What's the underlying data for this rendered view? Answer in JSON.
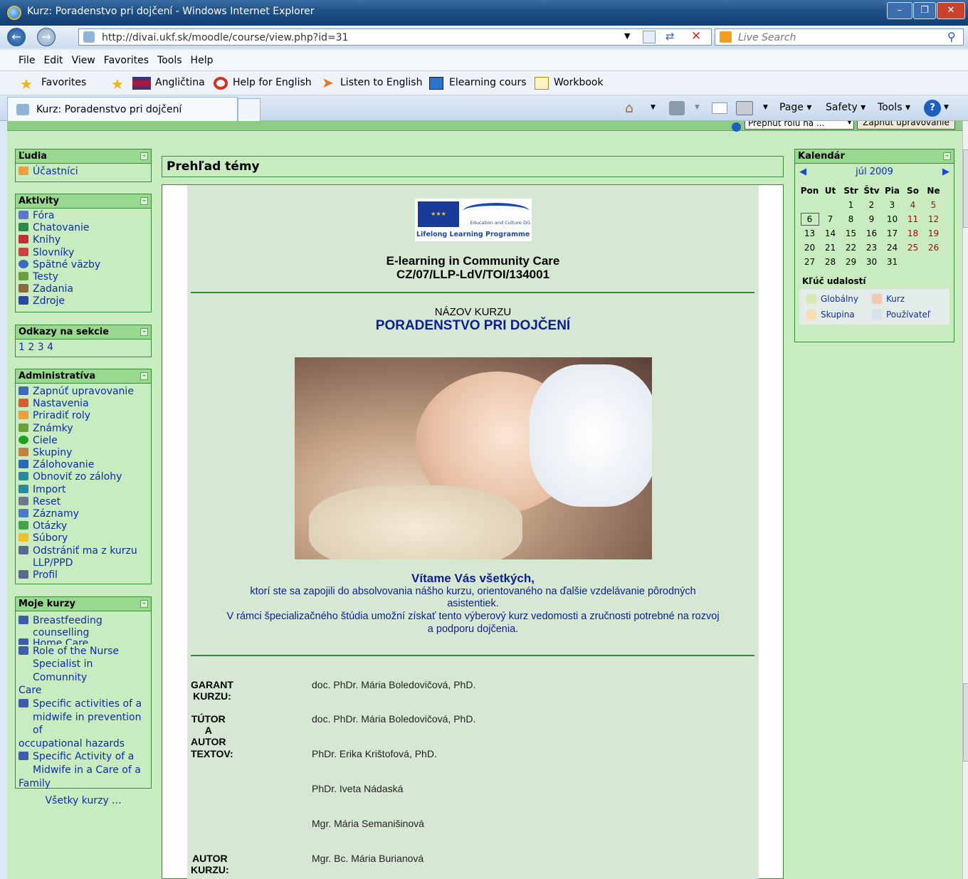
{
  "window": {
    "title": "Kurz: Poradenstvo pri dojčení - Windows Internet Explorer",
    "url": "http://divai.ukf.sk/moodle/course/view.php?id=31",
    "search_placeholder": "Live Search"
  },
  "menu": [
    "File",
    "Edit",
    "View",
    "Favorites",
    "Tools",
    "Help"
  ],
  "favorites": {
    "label": "Favorites",
    "items": [
      "Angličtina",
      "Help for English",
      "Listen to English",
      "Elearning cours",
      "Workbook"
    ]
  },
  "tab": {
    "label": "Kurz: Poradenstvo pri dojčení"
  },
  "commandbar": {
    "page": "Page",
    "safety": "Safety",
    "tools": "Tools"
  },
  "role_switch": {
    "select": "Prepnúť rolu na ...",
    "button": "Zapnúť upravovanie"
  },
  "blocks": {
    "ludia": {
      "title": "Ľudia",
      "items": [
        "Účastníci"
      ]
    },
    "aktivity": {
      "title": "Aktivity",
      "items": [
        "Fóra",
        "Chatovanie",
        "Knihy",
        "Slovníky",
        "Spätné väzby",
        "Testy",
        "Zadania",
        "Zdroje"
      ]
    },
    "odkazy": {
      "title": "Odkazy na sekcie",
      "text": "1 2 3 4"
    },
    "admin": {
      "title": "Administratíva",
      "items": [
        "Zapnúť upravovanie",
        "Nastavenia",
        "Priradiť roly",
        "Známky",
        "Ciele",
        "Skupiny",
        "Zálohovanie",
        "Obnoviť zo zálohy",
        "Import",
        "Reset",
        "Záznamy",
        "Otázky",
        "Súbory",
        "Odstrániť ma z kurzu",
        "LLP/PPD",
        "Profil"
      ]
    },
    "moje": {
      "title": "Moje kurzy",
      "items": [
        "Breastfeeding",
        "counselling",
        "Home Care",
        "Role of the Nurse",
        "Specialist in Comunnity",
        "Care",
        "Specific activities of a",
        "midwife in prevention of",
        "occupational hazards",
        "Specific Activity of a",
        "Midwife in a Care of a",
        "Family"
      ],
      "all": "Všetky kurzy ..."
    }
  },
  "main": {
    "section_title": "Prehľad témy",
    "logo": {
      "ec": "Education and Culture DG",
      "llp": "Lifelong Learning Programme"
    },
    "project_title": "E-learning in Community Care",
    "project_code": "CZ/07/LLP-LdV/TOI/134001",
    "course_name_label": "NÁZOV KURZU",
    "course_name": "PORADENSTVO PRI DOJČENÍ",
    "welcome_title": "Vítame Vás všetkých,",
    "welcome_lines": [
      "ktorí ste sa zapojili do absolvovania nášho kurzu, orientovaného na ďalšie vzdelávanie pôrodných",
      "asistentiek.",
      "V rámci špecializačného štúdia umožní získať tento výberový kurz vedomosti a zručnosti potrebné na rozvoj",
      "a podporu dojčenia."
    ],
    "credits": [
      {
        "label": "GARANT KURZU:",
        "value": "doc. PhDr. Mária Boledovičová, PhD."
      },
      {
        "label": "TÚTOR A AUTOR",
        "value": "doc. PhDr. Mária Boledovičová, PhD."
      },
      {
        "label": "TEXTOV:",
        "value": "PhDr. Erika Krištofová, PhD."
      },
      {
        "label": "",
        "value": "PhDr. Iveta Nádaská"
      },
      {
        "label": "",
        "value": "Mgr. Mária Semanišinová"
      },
      {
        "label": "AUTOR KURZU:",
        "value": "Mgr. Bc. Mária Burianová"
      }
    ]
  },
  "calendar": {
    "title": "Kalendár",
    "month": "júl 2009",
    "days": [
      "Pon",
      "Ut",
      "Str",
      "Štv",
      "Pia",
      "So",
      "Ne"
    ],
    "weeks": [
      [
        "",
        "",
        "1",
        "2",
        "3",
        "4",
        "5"
      ],
      [
        "6",
        "7",
        "8",
        "9",
        "10",
        "11",
        "12"
      ],
      [
        "13",
        "14",
        "15",
        "16",
        "17",
        "18",
        "19"
      ],
      [
        "20",
        "21",
        "22",
        "23",
        "24",
        "25",
        "26"
      ],
      [
        "27",
        "28",
        "29",
        "30",
        "31",
        "",
        ""
      ]
    ],
    "key_title": "Kľúč udalostí",
    "keys": [
      "Globálny",
      "Kurz",
      "Skupina",
      "Používateľ"
    ]
  },
  "colors": {
    "page_bg": "#c8ecc0",
    "block_head": "#98d88f",
    "link": "#0c2ea6",
    "border": "#3a8a3a"
  }
}
